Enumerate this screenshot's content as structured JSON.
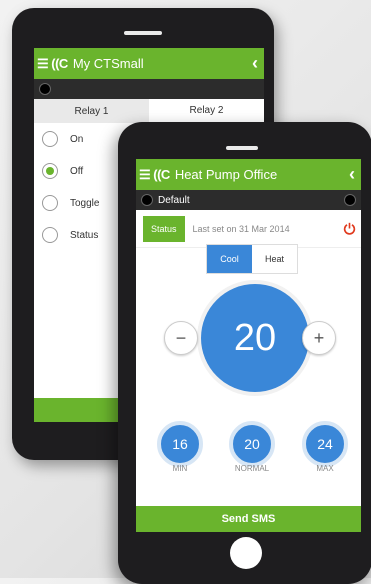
{
  "colors": {
    "accent": "#6ab42d",
    "blue": "#3a87d8",
    "dark": "#2c2c2c",
    "power": "#e03a1e"
  },
  "back_phone": {
    "brand": "☰ ((C",
    "title": "My CTSmall",
    "back_glyph": "‹",
    "tabs": [
      {
        "label": "Relay 1"
      },
      {
        "label": "Relay 2"
      }
    ],
    "options": [
      {
        "label": "On",
        "checked": false
      },
      {
        "label": "Off",
        "checked": true
      },
      {
        "label": "Toggle",
        "checked": false
      },
      {
        "label": "Status",
        "checked": false
      }
    ],
    "bottom_button": "S"
  },
  "front_phone": {
    "brand": "☰ ((C",
    "title": "Heat Pump Office",
    "back_glyph": "‹",
    "profile": "Default",
    "status_button": "Status",
    "status_text": "Last set on 31 Mar 2014",
    "modes": [
      {
        "label": "Cool",
        "selected": true
      },
      {
        "label": "Heat",
        "selected": false
      }
    ],
    "temperature": "20",
    "minus": "−",
    "plus": "+",
    "presets": [
      {
        "value": "16",
        "label": "MIN"
      },
      {
        "value": "20",
        "label": "NORMAL"
      },
      {
        "value": "24",
        "label": "MAX"
      }
    ],
    "send_button": "Send SMS"
  }
}
